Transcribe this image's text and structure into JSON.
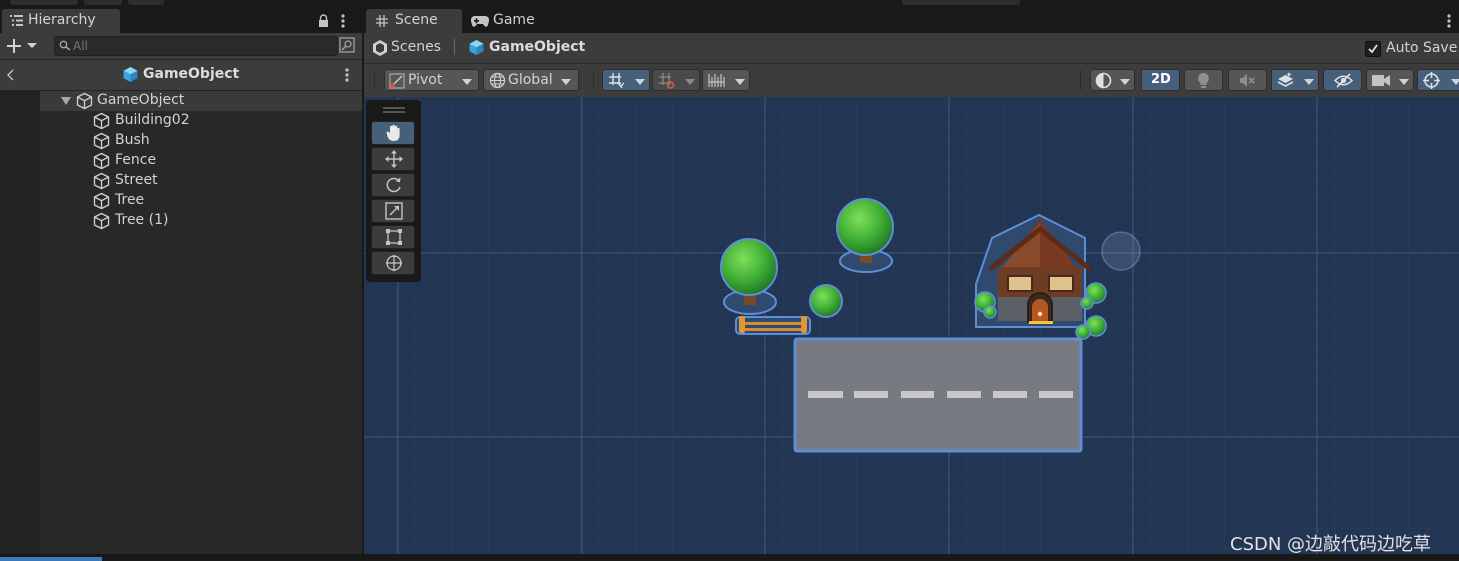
{
  "hierarchy": {
    "tab_label": "Hierarchy",
    "search_placeholder": "All",
    "header_title": "GameObject",
    "root": {
      "label": "GameObject"
    },
    "children": [
      {
        "label": "Building02"
      },
      {
        "label": "Bush"
      },
      {
        "label": "Fence"
      },
      {
        "label": "Street"
      },
      {
        "label": "Tree"
      },
      {
        "label": "Tree (1)"
      }
    ]
  },
  "scene_tabs": {
    "scene_label": "Scene",
    "game_label": "Game"
  },
  "breadcrumb": {
    "scenes_label": "Scenes",
    "current_label": "GameObject",
    "auto_save_label": "Auto Save",
    "auto_save_checked": true
  },
  "toolbar": {
    "pivot_label": "Pivot",
    "global_label": "Global",
    "mode_2d_label": "2D",
    "mode_2d_active": true
  },
  "tools": [
    "hand-tool",
    "move-tool",
    "rotate-tool",
    "scale-tool",
    "rect-tool",
    "transform-tool"
  ],
  "scene_objects": [
    "Tree",
    "Tree (1)",
    "Bush",
    "Fence",
    "Street",
    "Building02"
  ],
  "watermark": "CSDN @边敲代码边吃草",
  "colors": {
    "viewport_bg": "#223553",
    "grid_line": "#3b5577",
    "selection_outline": "#5e8ed6",
    "active_button": "#46607c",
    "panel_bg": "#3c3c3c",
    "accent_blue": "#3a79bb"
  }
}
